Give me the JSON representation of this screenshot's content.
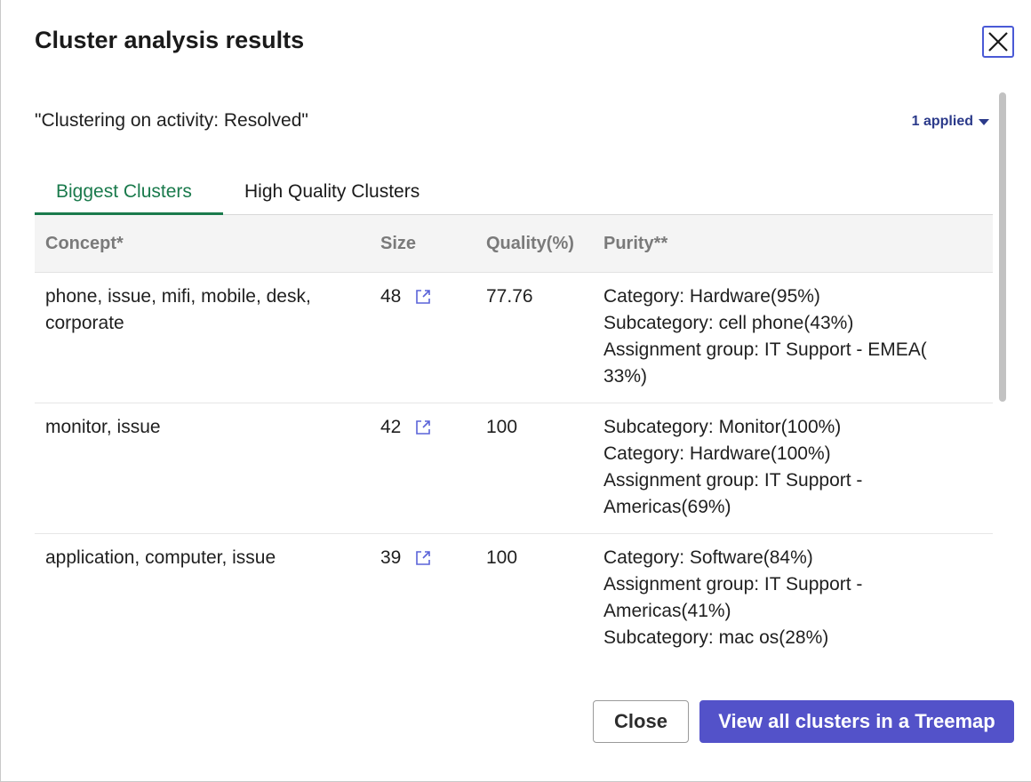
{
  "dialog": {
    "title": "Cluster analysis results",
    "close_icon": "close-x-icon"
  },
  "filter": {
    "text": "\"Clustering on activity: Resolved\"",
    "applied_label": "1 applied"
  },
  "tabs": [
    {
      "label": "Biggest Clusters",
      "active": true
    },
    {
      "label": "High Quality Clusters",
      "active": false
    }
  ],
  "table": {
    "headers": {
      "concept": "Concept*",
      "size": "Size",
      "quality": "Quality(%)",
      "purity": "Purity**"
    },
    "rows": [
      {
        "concept_line1": "phone, issue, mifi, mobile, desk,",
        "concept_line2": "corporate",
        "size": "48",
        "quality": "77.76",
        "purity": [
          "Category: Hardware(95%)",
          "Subcategory: cell phone(43%)",
          "Assignment group: IT Support - EMEA(",
          "33%)"
        ]
      },
      {
        "concept_line1": "monitor, issue",
        "concept_line2": "",
        "size": "42",
        "quality": "100",
        "purity": [
          "Subcategory: Monitor(100%)",
          "Category: Hardware(100%)",
          "Assignment group: IT Support -",
          "Americas(69%)"
        ]
      },
      {
        "concept_line1": "application, computer, issue",
        "concept_line2": "",
        "size": "39",
        "quality": "100",
        "purity": [
          "Category: Software(84%)",
          "Assignment group: IT Support -",
          "Americas(41%)",
          "Subcategory: mac os(28%)"
        ]
      }
    ]
  },
  "footer": {
    "close_label": "Close",
    "primary_label": "View all clusters in a Treemap"
  },
  "colors": {
    "accent_green": "#1a7a4c",
    "primary_purple": "#5352c9",
    "link_blue": "#4a5ad6"
  }
}
